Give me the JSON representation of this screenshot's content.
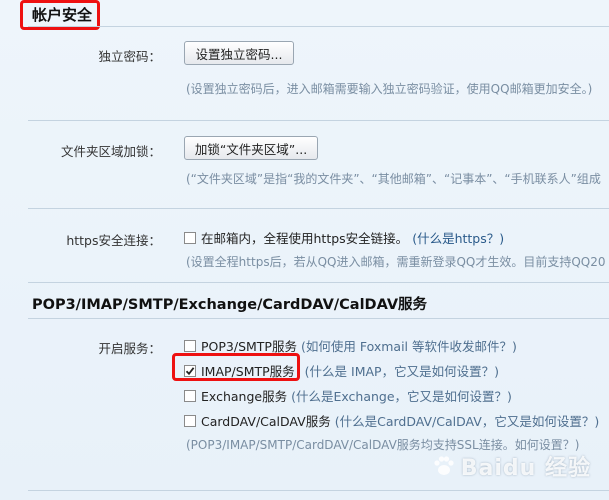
{
  "account_security": {
    "title": "帐户安全",
    "independent_password": {
      "label": "独立密码：",
      "button": "设置独立密码...",
      "hint": "(设置独立密码后，进入邮箱需要输入独立密码验证，使用QQ邮箱更加安全。)"
    },
    "folder_lock": {
      "label": "文件夹区域加锁：",
      "button": "加锁“文件夹区域”...",
      "hint": "(“文件夹区域”是指“我的文件夹”、“其他邮箱”、“记事本”、“手机联系人”组成"
    },
    "https": {
      "label": "https安全连接：",
      "checkbox_label": "在邮箱内，全程使用https安全链接。",
      "help": "(什么是https？)",
      "checked": false,
      "hint": "(设置全程https后，若从QQ进入邮箱，需重新登录QQ才生效。目前支持QQ20"
    }
  },
  "pop3_section": {
    "title": "POP3/IMAP/SMTP/Exchange/CardDAV/CalDAV服务",
    "enable_label": "开启服务：",
    "options": [
      {
        "label": "POP3/SMTP服务",
        "help": "(如何使用 Foxmail 等软件收发邮件？)",
        "checked": false
      },
      {
        "label": "IMAP/SMTP服务",
        "help": "(什么是 IMAP，它又是如何设置？)",
        "checked": true
      },
      {
        "label": "Exchange服务",
        "help": "(什么是Exchange，它又是如何设置？)",
        "checked": false
      },
      {
        "label": "CardDAV/CalDAV服务",
        "help": "(什么是CardDAV/CalDAV，它又是如何设置？)",
        "checked": false
      }
    ],
    "ssl_note": "(POP3/IMAP/SMTP/CardDAV/CalDAV服务均支持SSL连接。如何设置？)"
  },
  "watermark": {
    "text": "Baidu 经验"
  },
  "colors": {
    "highlight": "#ee1111",
    "hint": "#7a8ea2",
    "background": "#eaf2f9"
  }
}
